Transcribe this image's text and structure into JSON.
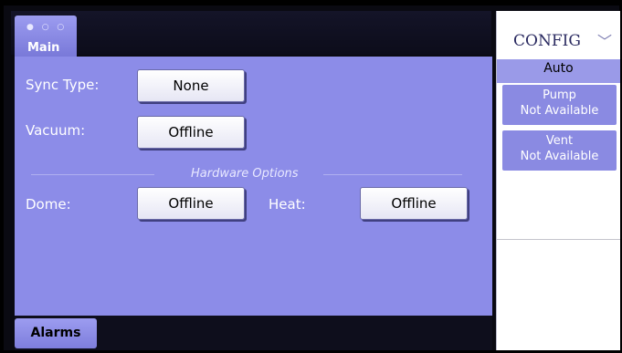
{
  "main_tab": {
    "dots": "● ○ ○",
    "label": "Main"
  },
  "fields": {
    "sync_type": {
      "label": "Sync Type:",
      "value": "None"
    },
    "vacuum": {
      "label": "Vacuum:",
      "value": "Offline"
    }
  },
  "hardware": {
    "section_title": "Hardware Options",
    "dome": {
      "label": "Dome:",
      "value": "Offline"
    },
    "heat": {
      "label": "Heat:",
      "value": "Offline"
    }
  },
  "alarms_label": "Alarms",
  "config": {
    "title": "CONFIG",
    "chevron": "﹀",
    "mode": "Auto",
    "pump": {
      "name": "Pump",
      "status": "Not Available"
    },
    "vent": {
      "name": "Vent",
      "status": "Not Available"
    }
  },
  "colors": {
    "panel_bg": "#8c8ce8",
    "button_bg": "#ffffff",
    "config_button_bg": "#8a8ae2",
    "screen_bg": "#0a0a12"
  }
}
